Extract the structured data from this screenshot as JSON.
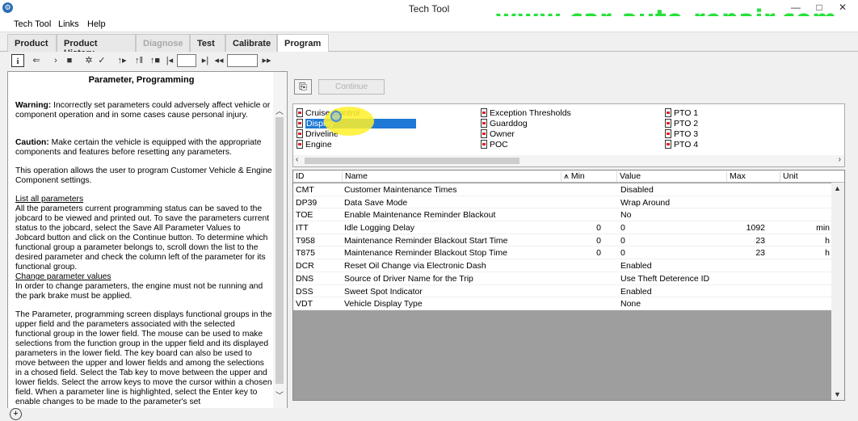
{
  "window": {
    "title": "Tech Tool",
    "watermark": "www.car-auto-repair.com",
    "controls": [
      "—",
      "□",
      "✕"
    ]
  },
  "menu": {
    "items": [
      "Tech Tool",
      "Links",
      "Help"
    ]
  },
  "tabs": [
    {
      "label": "Product",
      "state": "normal"
    },
    {
      "label": "Product History",
      "state": "normal"
    },
    {
      "label": "Diagnose",
      "state": "disabled"
    },
    {
      "label": "Test",
      "state": "normal"
    },
    {
      "label": "Calibrate",
      "state": "normal"
    },
    {
      "label": "Program",
      "state": "active"
    }
  ],
  "toolbar": {
    "icons": [
      "info-icon",
      "back-icon",
      "play-icon",
      "stop-icon",
      "bug-icon",
      "check-icon",
      "step-icon",
      "pause-icon",
      "record-icon",
      "first-icon",
      "page-input",
      "next-icon",
      "prev-icon",
      "page-input-2",
      "last-icon"
    ]
  },
  "help": {
    "title": "Parameter, Programming",
    "warning_label": "Warning:",
    "warning_text": " Incorrectly set parameters could adversely affect vehicle or component operation and in some cases cause personal injury.",
    "caution_label": "Caution:",
    "caution_text": " Make certain the vehicle is equipped with the appropriate components and features before resetting any parameters.",
    "intro": "This operation allows the user to program Customer Vehicle & Engine Component settings.",
    "list_heading": "List all parameters",
    "list_text": "All the parameters current programming status can be saved to the jobcard to be viewed and printed out. To save the parameters current status to the jobcard, select the Save All Parameter Values to Jobcard button and click on the Continue button. To determine which functional group a parameter belongs to, scroll down the list to the desired parameter and check the column left of the parameter for its functional group.",
    "change_heading": "Change parameter values",
    "change_text": "In order to change parameters, the engine must not be running and the park brake must be applied.",
    "screen_text": "The Parameter, programming screen displays functional groups in the upper field and the parameters associated with the selected functional group in the lower field. The mouse can be used to make selections from the function group in the upper field and its displayed parameters in the lower field. The key board can also be used to move between the upper and lower fields and among the selections in a chosed field. Select the Tab key to move between the upper and lower fields. Select the arrow keys to move the cursor within a chosen field. When a parameter line is highlighted, select the Enter key to enable changes to be made to the parameter's set"
  },
  "buttons": {
    "continue": "Continue"
  },
  "groups": {
    "col1": [
      "Cruise Control",
      "Display",
      "Driveline",
      "Engine"
    ],
    "col2": [
      "Exception Thresholds",
      "Guarddog",
      "Owner",
      "POC"
    ],
    "col3": [
      "PTO 1",
      "PTO 2",
      "PTO 3",
      "PTO 4"
    ],
    "selected": "Display"
  },
  "table": {
    "headers": [
      "ID",
      "Name",
      "Min",
      "Value",
      "Max",
      "Unit"
    ],
    "rows": [
      {
        "id": "CMT",
        "name": "Customer Maintenance Times",
        "min": "",
        "value": "Disabled",
        "max": "",
        "unit": ""
      },
      {
        "id": "DP39",
        "name": "Data Save Mode",
        "min": "",
        "value": "Wrap Around",
        "max": "",
        "unit": ""
      },
      {
        "id": "TOE",
        "name": "Enable Maintenance Reminder Blackout",
        "min": "",
        "value": "No",
        "max": "",
        "unit": ""
      },
      {
        "id": "ITT",
        "name": "Idle Logging Delay",
        "min": "0",
        "value": "0",
        "max": "1092",
        "unit": "min"
      },
      {
        "id": "T958",
        "name": "Maintenance Reminder Blackout Start Time",
        "min": "0",
        "value": "0",
        "max": "23",
        "unit": "h"
      },
      {
        "id": "T875",
        "name": "Maintenance Reminder Blackout Stop Time",
        "min": "0",
        "value": "0",
        "max": "23",
        "unit": "h"
      },
      {
        "id": "DCR",
        "name": "Reset Oil Change via Electronic Dash",
        "min": "",
        "value": "Enabled",
        "max": "",
        "unit": ""
      },
      {
        "id": "DNS",
        "name": "Source of Driver Name for the Trip",
        "min": "",
        "value": "Use Theft Deterence ID",
        "max": "",
        "unit": ""
      },
      {
        "id": "DSS",
        "name": "Sweet Spot Indicator",
        "min": "",
        "value": "Enabled",
        "max": "",
        "unit": ""
      },
      {
        "id": "VDT",
        "name": "Vehicle Display Type",
        "min": "",
        "value": "None",
        "max": "",
        "unit": ""
      }
    ]
  }
}
